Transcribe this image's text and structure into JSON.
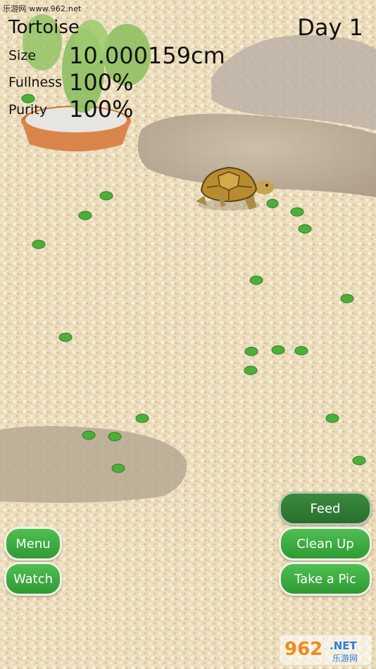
{
  "watermark_top": "乐游网 www.962.net",
  "pet": {
    "name": "Tortoise",
    "day": "Day 1"
  },
  "stats": {
    "size_label": "Size",
    "size_value": "10.000159cm",
    "fullness_label": "Fullness",
    "fullness_value": "100%",
    "purity_label": "Purity",
    "purity_value": "100%"
  },
  "buttons": {
    "feed": "Feed",
    "clean_up": "Clean Up",
    "take_pic": "Take a Pic",
    "menu": "Menu",
    "watch": "Watch"
  },
  "logo": {
    "number": "962",
    "suffix": ".NET",
    "cn_text": "乐游网"
  },
  "colors": {
    "button_green": "#3fae43",
    "sand": "#e9d9b6",
    "leaf_green": "#4caf3a"
  }
}
